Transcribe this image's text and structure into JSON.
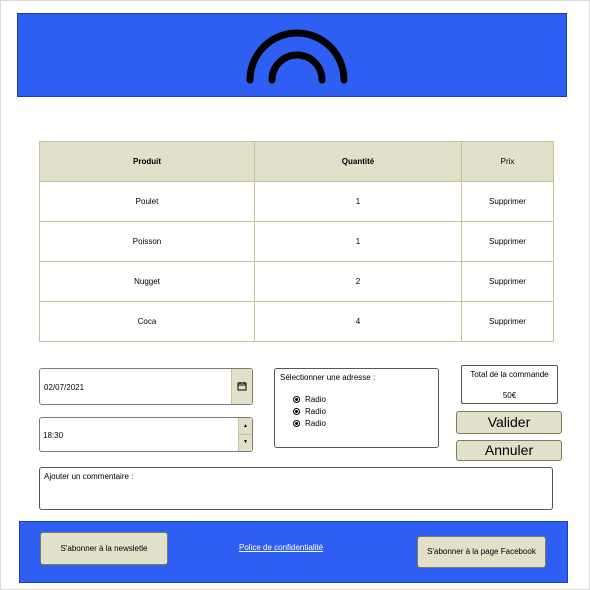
{
  "table": {
    "headers": [
      "Produit",
      "Quantité",
      "Prix"
    ],
    "rows": [
      {
        "produit": "Poulet",
        "quantite": "1",
        "action": "Supprimer"
      },
      {
        "produit": "Poisson",
        "quantite": "1",
        "action": "Supprimer"
      },
      {
        "produit": "Nugget",
        "quantite": "2",
        "action": "Supprimer"
      },
      {
        "produit": "Coca",
        "quantite": "4",
        "action": "Supprimer"
      }
    ]
  },
  "form": {
    "date": "02/07/2021",
    "time": "18:30",
    "address": {
      "title": "Sélectionner une adresse :",
      "options": [
        "Radio",
        "Radio",
        "Radio"
      ]
    },
    "comment_label": "Ajouter un commentaire :"
  },
  "total": {
    "label": "Total de la commande",
    "value": "50€"
  },
  "buttons": {
    "valider": "Valider",
    "annuler": "Annuler"
  },
  "footer": {
    "newsletter": "S'abonner à la newsletle",
    "privacy": "Police de confidentialité",
    "facebook": "S'abonner à la page Facebook"
  },
  "icons": {
    "logo": "arch-logo-icon",
    "calendar": "calendar-icon",
    "spinner": "spinner-arrows-icon"
  },
  "colors": {
    "brand_blue": "#2f5ef2",
    "beige": "#e1e0c9"
  }
}
